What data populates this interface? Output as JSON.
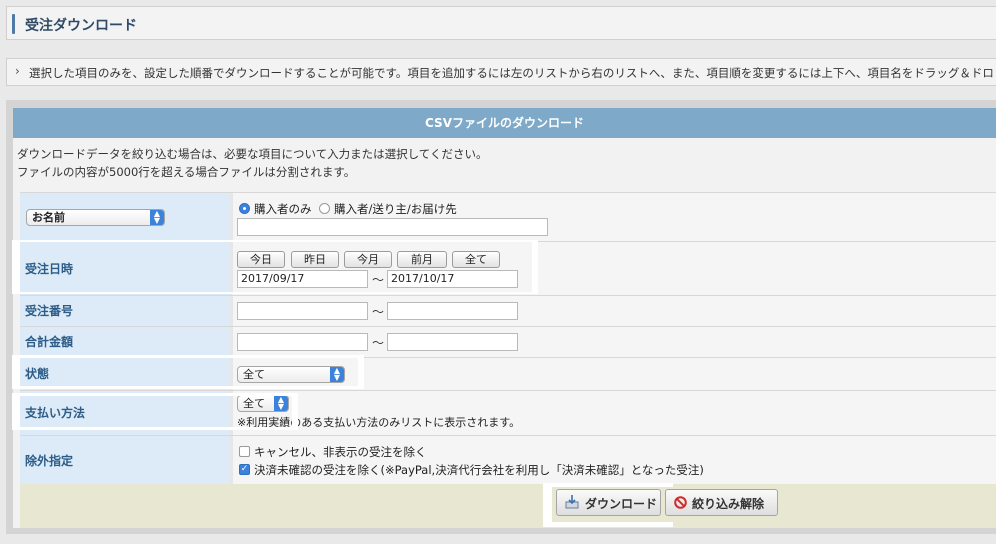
{
  "page_title": "受注ダウンロード",
  "description": "選択した項目のみを、設定した順番でダウンロードすることが可能です。項目を追加するには左のリストから右のリストへ、また、項目順を変更するには上下へ、項目名をドラッグ＆ドロップし",
  "panel": {
    "title": "CSVファイルのダウンロード",
    "info1": "ダウンロードデータを絞り込む場合は、必要な項目について入力または選択してください。",
    "info2": "ファイルの内容が5000行を超える場合ファイルは分割されます。"
  },
  "name_row": {
    "select_value": "お名前",
    "radio_buyer": "購入者のみ",
    "radio_all": "購入者/送り主/お届け先",
    "input_value": ""
  },
  "date_row": {
    "label": "受注日時",
    "buttons": [
      "今日",
      "昨日",
      "今月",
      "前月",
      "全て"
    ],
    "from": "2017/09/17",
    "to": "2017/10/17",
    "sep": "～"
  },
  "order_no_row": {
    "label": "受注番号",
    "sep": "～"
  },
  "total_row": {
    "label": "合計金額",
    "sep": "～"
  },
  "status_row": {
    "label": "状態",
    "select_value": "全て"
  },
  "payment_row": {
    "label": "支払い方法",
    "select_value": "全て",
    "note": "※利用実績のある支払い方法のみリストに表示されます。"
  },
  "exclude_row": {
    "label": "除外指定",
    "opt1": "キャンセル、非表示の受注を除く",
    "opt1_checked": false,
    "opt2": "決済未確認の受注を除く(※PayPal,決済代行会社を利用し「決済未確認」となった受注)",
    "opt2_checked": true
  },
  "actions": {
    "download": "ダウンロード",
    "reset": "絞り込み解除"
  },
  "colors": {
    "header_blue": "#7ea9c9",
    "label_bg": "#dcebf7",
    "accent": "#3b82dd"
  }
}
